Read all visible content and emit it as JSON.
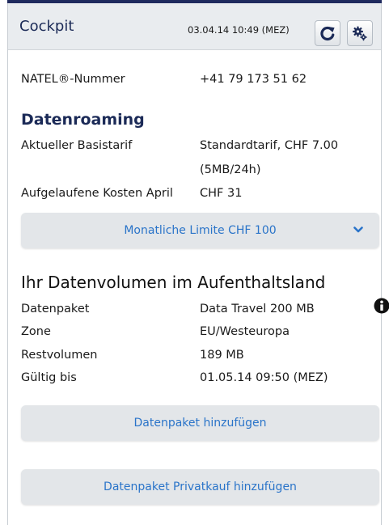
{
  "header": {
    "title": "Cockpit",
    "timestamp": "03.04.14 10:49 (MEZ)",
    "refresh_icon": "refresh-icon",
    "settings_icon": "gears-icon"
  },
  "account": {
    "natel_label": "NATEL®-Nummer",
    "natel_value": "+41 79 173 51 62"
  },
  "roaming": {
    "title": "Datenroaming",
    "base_rate_label": "Aktueller Basistarif",
    "base_rate_value_line1": "Standardtarif, CHF 7.00",
    "base_rate_value_line2": "(5MB/24h)",
    "costs_label": "Aufgelaufene Kosten April",
    "costs_value": "CHF 31",
    "limit_button": "Monatliche Limite CHF 100",
    "limit_icon": "chevron-down-icon"
  },
  "volume": {
    "title": "Ihr Datenvolumen im Aufenthaltsland",
    "package_label": "Datenpaket",
    "package_value": "Data Travel 200 MB",
    "package_info_icon": "info-icon",
    "zone_label": "Zone",
    "zone_value": "EU/Westeuropa",
    "remaining_label": "Restvolumen",
    "remaining_value": "189 MB",
    "valid_label": "Gültig bis",
    "valid_value": "01.05.14 09:50 (MEZ)"
  },
  "actions": {
    "add_package": "Datenpaket hinzufügen",
    "add_private_package": "Datenpaket Privatkauf hinzufügen"
  },
  "colors": {
    "accent": "#2a74c9",
    "heading": "#1b2a57",
    "header_bg": "#e9ecef",
    "button_bg": "#e3e6e9"
  }
}
